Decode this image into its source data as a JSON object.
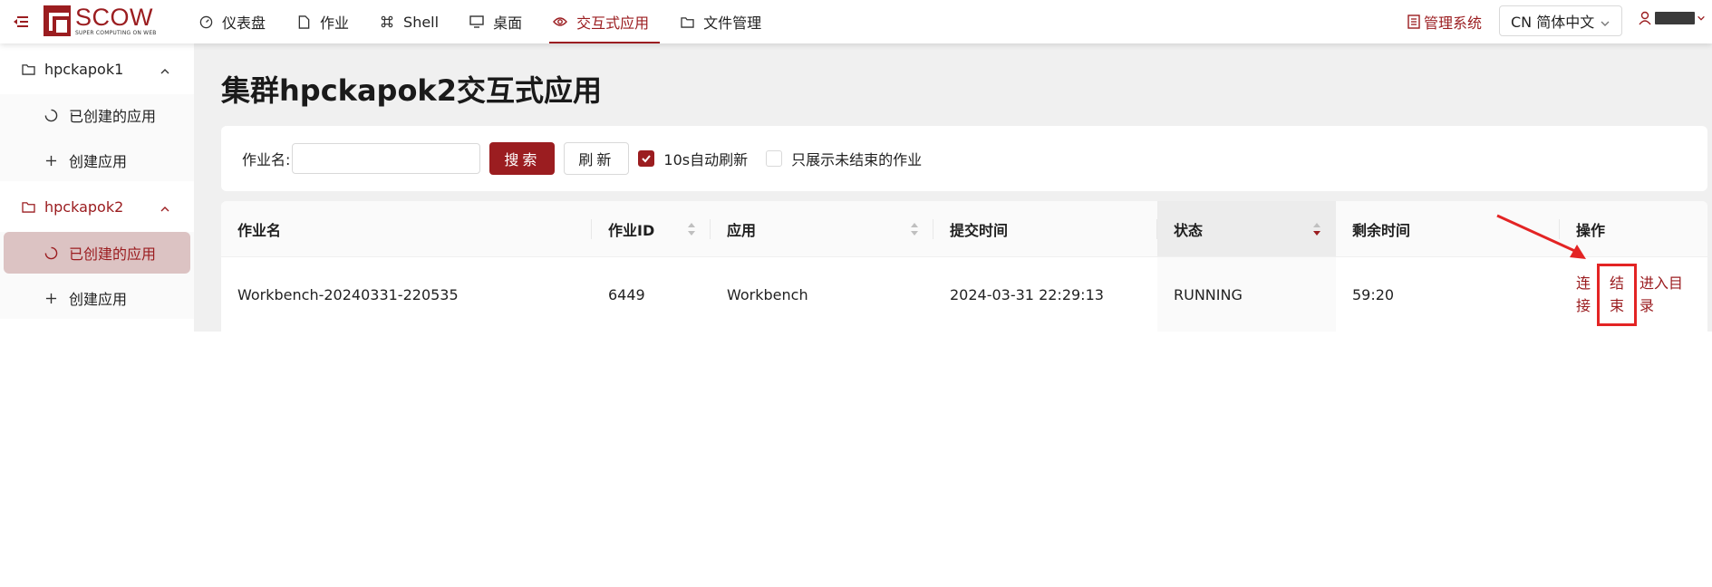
{
  "header": {
    "logo_text": "SCOW",
    "logo_subtitle": "SUPER COMPUTING ON WEB",
    "nav": [
      {
        "label": "仪表盘",
        "icon": "dashboard-icon"
      },
      {
        "label": "作业",
        "icon": "file-icon"
      },
      {
        "label": "Shell",
        "icon": "command-icon"
      },
      {
        "label": "桌面",
        "icon": "desktop-icon"
      },
      {
        "label": "交互式应用",
        "icon": "eye-icon",
        "active": true
      },
      {
        "label": "文件管理",
        "icon": "folder-icon"
      }
    ],
    "admin_link": "管理系统",
    "language": "CN 简体中文"
  },
  "sidebar": {
    "groups": [
      {
        "label": "hpckapok1",
        "items": [
          {
            "label": "已创建的应用"
          },
          {
            "label": "创建应用"
          }
        ]
      },
      {
        "label": "hpckapok2",
        "active": true,
        "items": [
          {
            "label": "已创建的应用",
            "active": true
          },
          {
            "label": "创建应用"
          }
        ]
      }
    ]
  },
  "main": {
    "title": "集群hpckapok2交互式应用",
    "filter": {
      "job_name_label": "作业名:",
      "job_name_value": "",
      "search_button": "搜索",
      "refresh_button": "刷新",
      "auto_refresh_label": "10s自动刷新",
      "auto_refresh_checked": true,
      "unfinished_only_label": "只展示未结束的作业",
      "unfinished_only_checked": false
    },
    "table": {
      "columns": [
        "作业名",
        "作业ID",
        "应用",
        "提交时间",
        "状态",
        "剩余时间",
        "操作"
      ],
      "rows": [
        {
          "job_name": "Workbench-20240331-220535",
          "job_id": "6449",
          "app": "Workbench",
          "submit_time": "2024-03-31 22:29:13",
          "status": "RUNNING",
          "remaining": "59:20",
          "actions": {
            "connect": "连接",
            "end": "结束",
            "open_dir": "进入目录"
          }
        }
      ]
    }
  },
  "colors": {
    "brand": "#9b1d20",
    "annotation": "#e32424"
  }
}
